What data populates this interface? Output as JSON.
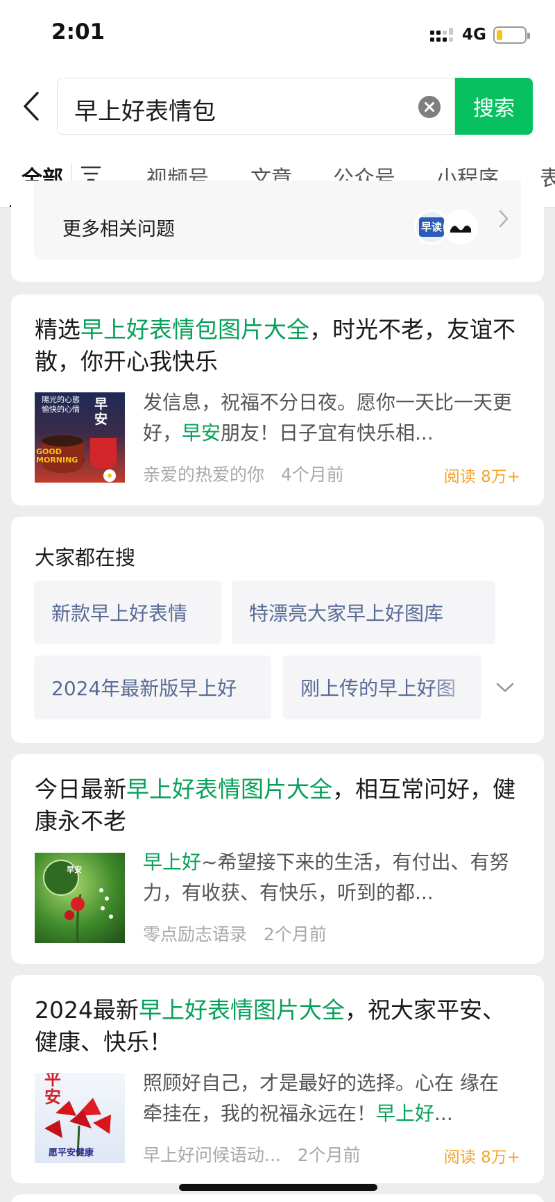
{
  "status": {
    "time": "2:01",
    "network": "4G",
    "battery_level": 0.2
  },
  "search": {
    "query": "早上好表情包",
    "button_label": "搜索"
  },
  "tabs": [
    "全部",
    "视频号",
    "文章",
    "公众号",
    "小程序",
    "表"
  ],
  "related": {
    "label": "更多相关问题",
    "avatar_text": "早读"
  },
  "results": [
    {
      "title": {
        "pre": "精选",
        "hl": "早上好表情包图片大全",
        "post": "，时光不老，友谊不散，你开心我快乐"
      },
      "desc": {
        "pre": "发信息，祝福不分日夜。愿你一天比一天更好，",
        "hl": "早安",
        "post": "朋友！日子宜有快乐相..."
      },
      "source": "亲爱的热爱的你",
      "time": "4个月前",
      "reads": "阅读 8万+",
      "thumb_text": {
        "line1": "陽光的心態",
        "line2": "愉快的心情",
        "big": "早安",
        "en": "GOOD MORNING"
      }
    },
    {
      "title": {
        "pre": "今日最新",
        "hl": "早上好表情图片大全",
        "post": "，相互常问好，健康永不老"
      },
      "desc": {
        "pre": "",
        "hl": "早上好",
        "post": "~希望接下来的生活，有付出、有努力，有收获、有快乐，听到的都..."
      },
      "source": "零点励志语录",
      "time": "2个月前",
      "reads": "",
      "thumb_text": {
        "big": "早安"
      }
    },
    {
      "title": {
        "pre": "2024最新",
        "hl": "早上好表情图片大全",
        "post": "，祝大家平安、健康、快乐！"
      },
      "desc": {
        "pre": "照顾好自己，才是最好的选择。心在 缘在 牵挂在，我的祝福永远在！",
        "hl": "早上好",
        "post": "..."
      },
      "source": "早上好问候语动...",
      "time": "2个月前",
      "reads": "阅读 8万+",
      "thumb_text": {
        "big": "平安",
        "line1": "愿平安健康"
      }
    }
  ],
  "hot": {
    "title": "大家都在搜",
    "chips": [
      "新款早上好表情",
      "特漂亮大家早上好图库",
      "2024年最新版早上好",
      "刚上传的早上好图"
    ]
  },
  "colors": {
    "accent": "#07c160",
    "highlight": "#07a05a",
    "link": "#576b95",
    "reads": "#f3a32b"
  }
}
